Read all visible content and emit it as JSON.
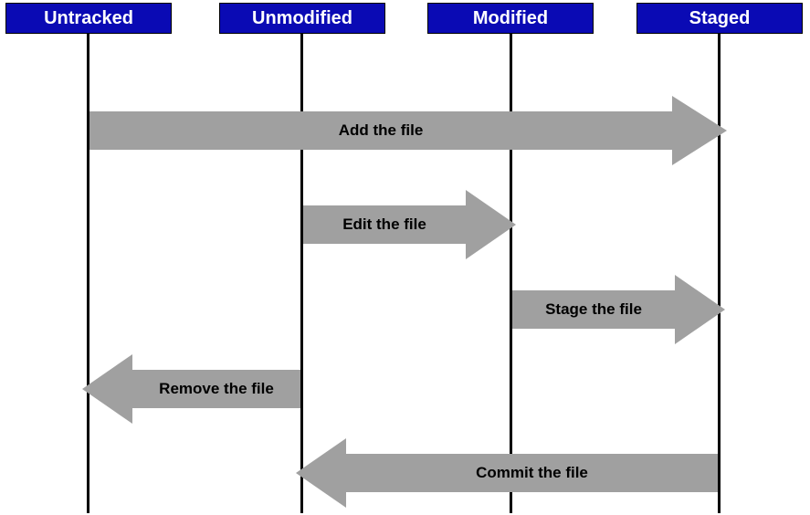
{
  "columns": {
    "untracked": "Untracked",
    "unmodified": "Unmodified",
    "modified": "Modified",
    "staged": "Staged"
  },
  "arrows": {
    "add": "Add the file",
    "edit": "Edit the file",
    "stage": "Stage the file",
    "remove": "Remove the file",
    "commit": "Commit the file"
  },
  "colors": {
    "header_bg": "#0a0ab4",
    "header_text": "#ffffff",
    "arrow_fill": "#a0a0a0",
    "arrow_text": "#000000",
    "line": "#000000"
  },
  "diagram": {
    "type": "state-transition",
    "states": [
      "Untracked",
      "Unmodified",
      "Modified",
      "Staged"
    ],
    "transitions": [
      {
        "from": "Untracked",
        "to": "Staged",
        "label": "Add the file"
      },
      {
        "from": "Unmodified",
        "to": "Modified",
        "label": "Edit the file"
      },
      {
        "from": "Modified",
        "to": "Staged",
        "label": "Stage the file"
      },
      {
        "from": "Unmodified",
        "to": "Untracked",
        "label": "Remove the file"
      },
      {
        "from": "Staged",
        "to": "Unmodified",
        "label": "Commit the file"
      }
    ]
  }
}
